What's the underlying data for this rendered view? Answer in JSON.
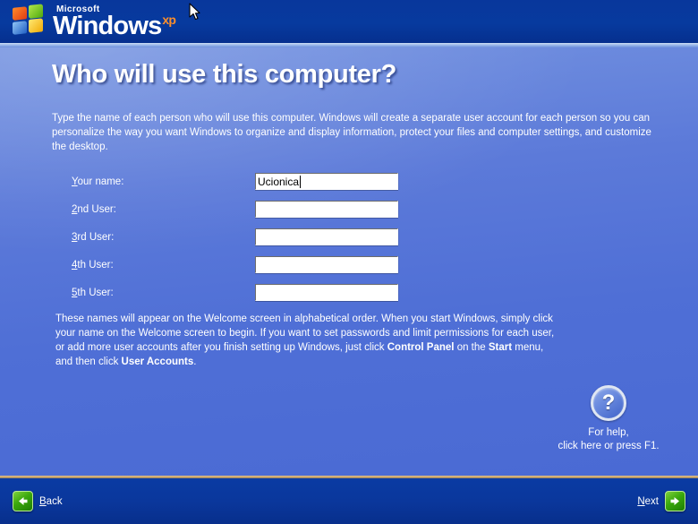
{
  "header": {
    "brand_microsoft": "Microsoft",
    "brand_windows": "Windows",
    "brand_xp": "xp",
    "logo_icon": "windows-flag-icon",
    "cursor_icon": "mouse-pointer-arrow-icon"
  },
  "page": {
    "title": "Who will use this computer?",
    "intro": "Type the name of each person who will use this computer. Windows will create a separate user account for each person so you can personalize the way you want Windows to organize and display information, protect your files and computer settings, and customize the desktop."
  },
  "form": {
    "fields": [
      {
        "label_accel": "Y",
        "label_rest": "our name:",
        "value": "Ucionica",
        "focused": true
      },
      {
        "label_accel": "2",
        "label_rest": "nd User:",
        "value": "",
        "focused": false
      },
      {
        "label_accel": "3",
        "label_rest": "rd User:",
        "value": "",
        "focused": false
      },
      {
        "label_accel": "4",
        "label_rest": "th User:",
        "value": "",
        "focused": false
      },
      {
        "label_accel": "5",
        "label_rest": "th User:",
        "value": "",
        "focused": false
      }
    ]
  },
  "note": {
    "part1": "These names will appear on the Welcome screen in alphabetical order. When you start Windows, simply click your name on the Welcome screen to begin. If you want to set passwords and limit permissions for each user, or add more user accounts after you finish setting up Windows, just click ",
    "bold1": "Control Panel",
    "part2": " on the ",
    "bold2": "Start",
    "part3": " menu, and then click ",
    "bold3": "User Accounts",
    "part4": "."
  },
  "help": {
    "icon": "question-mark-icon",
    "glyph": "?",
    "line1": "For help,",
    "line2": "click here or press F1."
  },
  "footer": {
    "back_accel": "B",
    "back_rest": "ack",
    "back_icon": "arrow-left-icon",
    "next_accel": "N",
    "next_rest": "ext",
    "next_icon": "arrow-right-icon"
  },
  "colors": {
    "header_blue": "#073a9e",
    "body_blue": "#5272d8",
    "accent_green": "#3aa80c",
    "accent_orange": "#ff8f2a",
    "footer_rule": "#c6a370"
  }
}
